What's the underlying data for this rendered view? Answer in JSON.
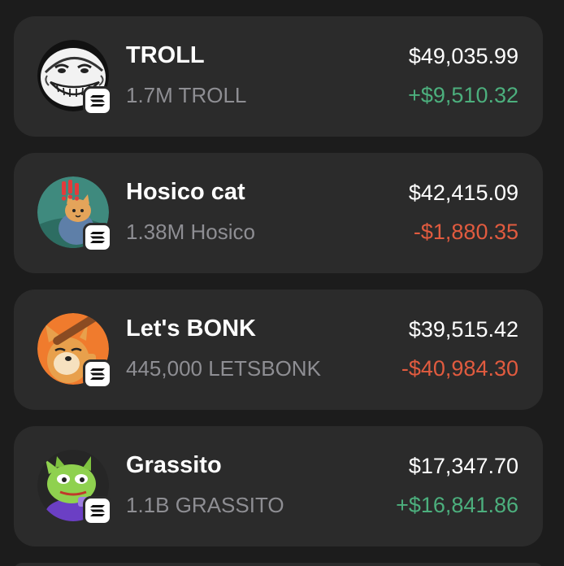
{
  "tokens": [
    {
      "name": "TROLL",
      "amount": "1.7M TROLL",
      "value": "$49,035.99",
      "change": "+$9,510.32",
      "change_direction": "positive",
      "avatar_icon": "troll-face-icon",
      "chain_icon": "solana-icon"
    },
    {
      "name": "Hosico cat",
      "amount": "1.38M Hosico",
      "value": "$42,415.09",
      "change": "-$1,880.35",
      "change_direction": "negative",
      "avatar_icon": "hosico-cat-icon",
      "chain_icon": "solana-icon"
    },
    {
      "name": "Let's BONK",
      "amount": "445,000 LETSBONK",
      "value": "$39,515.42",
      "change": "-$40,984.30",
      "change_direction": "negative",
      "avatar_icon": "bonk-dog-icon",
      "chain_icon": "solana-icon"
    },
    {
      "name": "Grassito",
      "amount": "1.1B GRASSITO",
      "value": "$17,347.70",
      "change": "+$16,841.86",
      "change_direction": "positive",
      "avatar_icon": "grassito-frog-icon",
      "chain_icon": "solana-icon"
    }
  ],
  "colors": {
    "background": "#1c1c1c",
    "card": "#2b2b2b",
    "positive": "#4caf7d",
    "negative": "#e15b3f",
    "secondary_text": "#8e8e93"
  }
}
